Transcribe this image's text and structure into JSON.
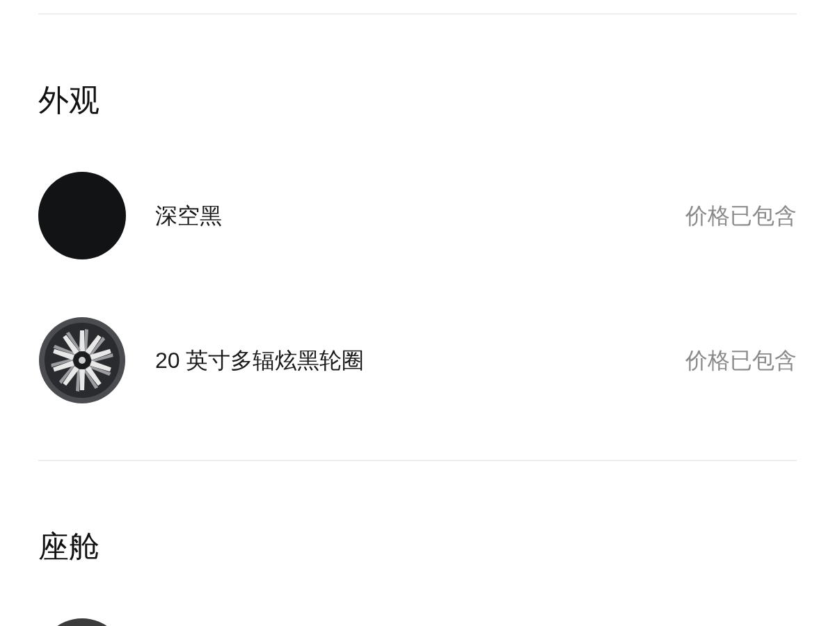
{
  "sections": [
    {
      "title": "外观",
      "items": [
        {
          "kind": "swatch",
          "color": "#111315",
          "name": "深空黑",
          "price": "价格已包含"
        },
        {
          "kind": "wheel",
          "name": "20 英寸多辐炫黑轮圈",
          "price": "价格已包含"
        }
      ]
    },
    {
      "title": "座舱",
      "items": [
        {
          "kind": "swatch",
          "color": "#3c3c3c"
        }
      ]
    }
  ]
}
